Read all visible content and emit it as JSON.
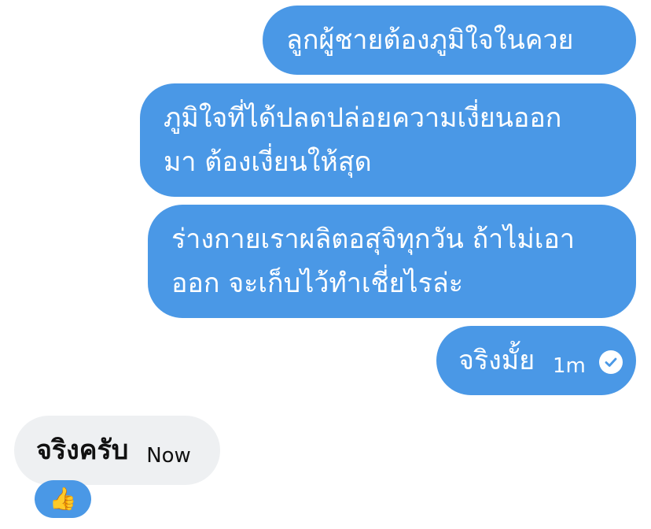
{
  "colors": {
    "sent_bubble": "#4a98e6",
    "received_bubble": "#eef0f2",
    "background": "#ffffff"
  },
  "messages": [
    {
      "direction": "sent",
      "lines": [
        "ลูกผู้ชายต้องภูมิใจในควย"
      ]
    },
    {
      "direction": "sent",
      "lines": [
        "ภูมิใจที่ได้ปลดปล่อยความเงี่ยนออก",
        "มา ต้องเงี่ยนให้สุด"
      ]
    },
    {
      "direction": "sent",
      "lines": [
        "ร่างกายเราผลิตอสุจิทุกวัน ถ้าไม่เอา",
        "ออก จะเก็บไว้ทำเชี่ยไรล่ะ"
      ]
    },
    {
      "direction": "sent",
      "text": "จริงมั้ย",
      "time": "1m",
      "status_icon": "check-circle-icon"
    },
    {
      "direction": "received",
      "text": "จริงครับ",
      "time": "Now",
      "reaction": "👍"
    }
  ]
}
